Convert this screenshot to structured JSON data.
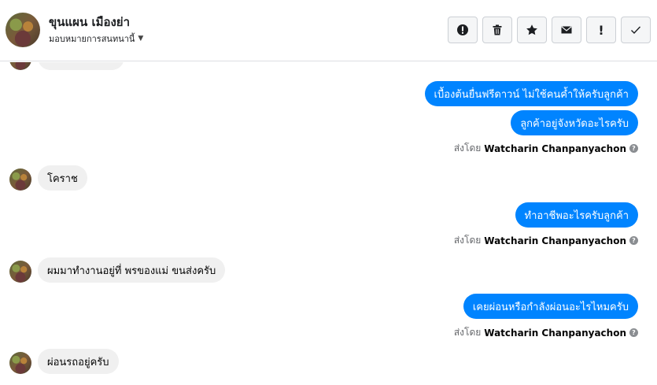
{
  "header": {
    "name": "ขุนแผน เมืองย่า",
    "assign_label": "มอบหมายการสนทนานี้",
    "actions": [
      {
        "icon": "alert-circle-icon"
      },
      {
        "icon": "trash-icon"
      },
      {
        "icon": "star-icon"
      },
      {
        "icon": "envelope-icon"
      },
      {
        "icon": "exclamation-icon",
        "label": "!"
      },
      {
        "icon": "check-icon"
      }
    ]
  },
  "messages": [
    {
      "dir": "out",
      "text": "เบื้องต้นยื่นฟรีดาวน์ ไม่ใช้คนค้ำให้ครับลูกค้า"
    },
    {
      "dir": "out",
      "text": "ลูกค้าอยู่จังหวัดอะไรครับ"
    },
    {
      "sent_by_prefix": "ส่งโดย",
      "sent_by_name": "Watcharin Chanpanyachon"
    },
    {
      "dir": "in",
      "text": "โคราช"
    },
    {
      "dir": "out",
      "text": "ทำอาชีพอะไรครับลูกค้า"
    },
    {
      "sent_by_prefix": "ส่งโดย",
      "sent_by_name": "Watcharin Chanpanyachon"
    },
    {
      "dir": "in",
      "text": "ผมมาทำงานอยู่ที่ พรของแม่ ขนส่งครับ"
    },
    {
      "dir": "out",
      "text": "เคยผ่อนหรือกำลังผ่อนอะไรไหมครับ"
    },
    {
      "sent_by_prefix": "ส่งโดย",
      "sent_by_name": "Watcharin Chanpanyachon"
    },
    {
      "dir": "in",
      "text": "ผ่อนรถอยู่ครับ"
    }
  ],
  "colors": {
    "outgoing": "#0084ff",
    "incoming": "#f0f0f0"
  }
}
